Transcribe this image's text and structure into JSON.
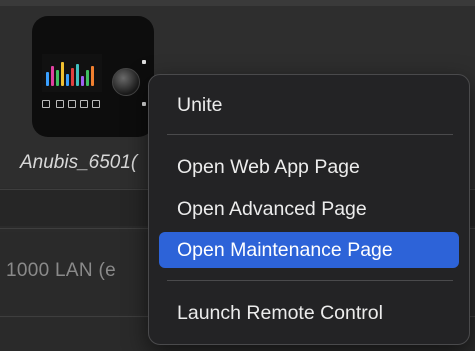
{
  "device": {
    "name": "Anubis_6501("
  },
  "background": {
    "network_field": "1000 LAN  (e"
  },
  "context_menu": {
    "items": [
      {
        "label": "Unite",
        "highlighted": false
      },
      {
        "label": "Open Web App Page",
        "highlighted": false
      },
      {
        "label": "Open Advanced Page",
        "highlighted": false
      },
      {
        "label": "Open Maintenance Page",
        "highlighted": true
      },
      {
        "label": "Launch Remote Control",
        "highlighted": false
      }
    ]
  },
  "colors": {
    "menu_highlight": "#2d63d8",
    "menu_background": "#232325",
    "window_background": "#2b2b2b"
  }
}
